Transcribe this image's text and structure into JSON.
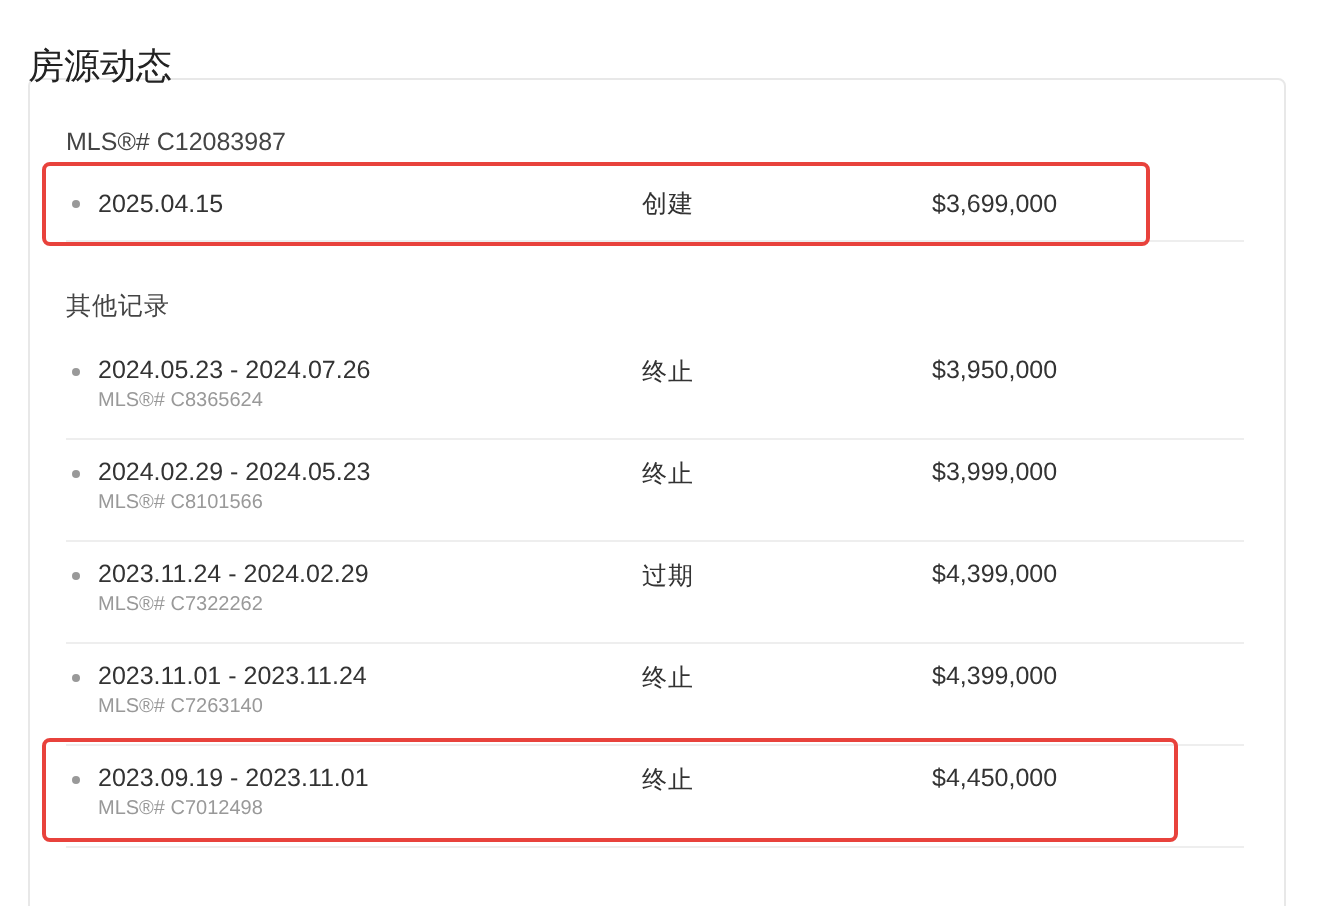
{
  "title": "房源动态",
  "current": {
    "mls": "MLS®# C12083987",
    "row": {
      "date": "2025.04.15",
      "status": "创建",
      "price": "$3,699,000",
      "highlighted": true
    }
  },
  "history": {
    "heading": "其他记录",
    "rows": [
      {
        "date": "2024.05.23 - 2024.07.26",
        "mls": "MLS®# C8365624",
        "status": "终止",
        "price": "$3,950,000",
        "highlighted": false
      },
      {
        "date": "2024.02.29 - 2024.05.23",
        "mls": "MLS®# C8101566",
        "status": "终止",
        "price": "$3,999,000",
        "highlighted": false
      },
      {
        "date": "2023.11.24 - 2024.02.29",
        "mls": "MLS®# C7322262",
        "status": "过期",
        "price": "$4,399,000",
        "highlighted": false
      },
      {
        "date": "2023.11.01 - 2023.11.24",
        "mls": "MLS®# C7263140",
        "status": "终止",
        "price": "$4,399,000",
        "highlighted": false
      },
      {
        "date": "2023.09.19 - 2023.11.01",
        "mls": "MLS®# C7012498",
        "status": "终止",
        "price": "$4,450,000",
        "highlighted": true
      }
    ]
  }
}
